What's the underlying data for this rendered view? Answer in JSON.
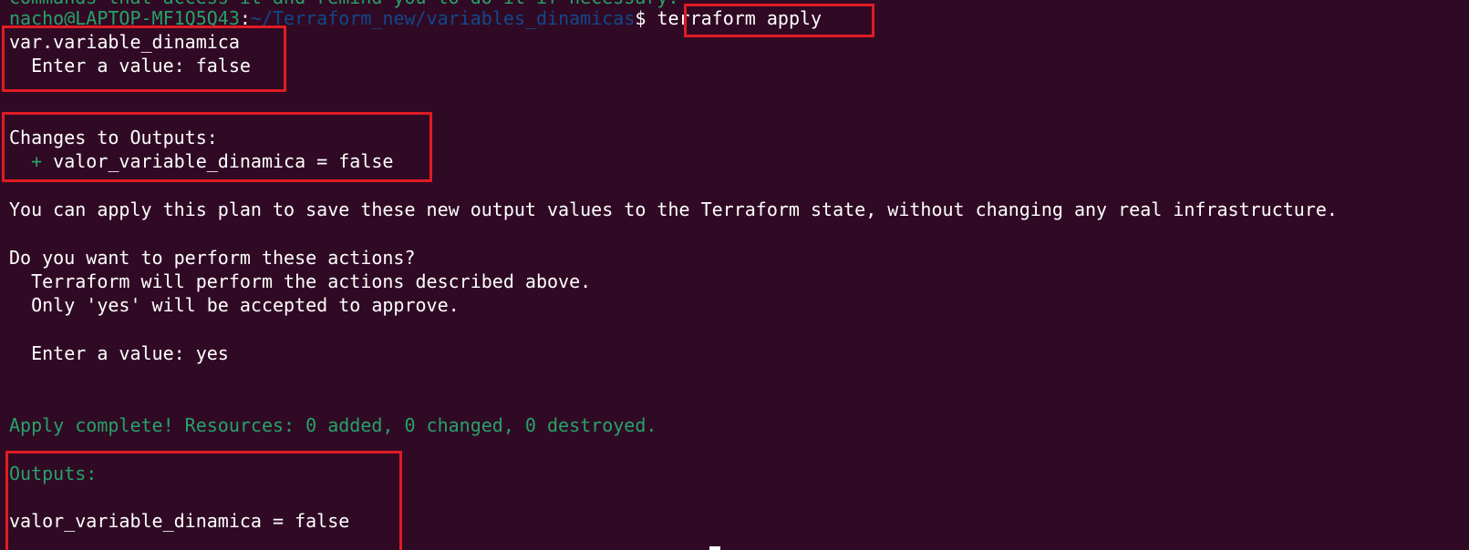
{
  "terminal": {
    "cut_line": "commands that access it and remind you to do it if necessary.",
    "prompt": {
      "user_host": "nacho@LAPTOP-MF1Q5Q43",
      "separator": ":",
      "path": "~/Terraform_new/variables_dinamicas",
      "symbol": "$ ",
      "command": "terraform apply"
    },
    "var_name": "var.variable_dinamica",
    "var_prompt": "  Enter a value: false",
    "changes_header": "Changes to Outputs:",
    "changes_plus": "+",
    "changes_item": " valor_variable_dinamica = false",
    "apply_info": "You can apply this plan to save these new output values to the Terraform state, without changing any real infrastructure.",
    "confirm_question": "Do you want to perform these actions?",
    "confirm_line1": "  Terraform will perform the actions described above.",
    "confirm_line2": "  Only 'yes' will be accepted to approve.",
    "confirm_prompt": "  Enter a value: yes",
    "apply_complete": "Apply complete! Resources: 0 added, 0 changed, 0 destroyed.",
    "outputs_header": "Outputs:",
    "output_value": "valor_variable_dinamica = false"
  },
  "colors": {
    "background": "#300a24",
    "prompt_green": "#26a269",
    "path_blue": "#12488b",
    "highlight_red": "#e01b24"
  }
}
